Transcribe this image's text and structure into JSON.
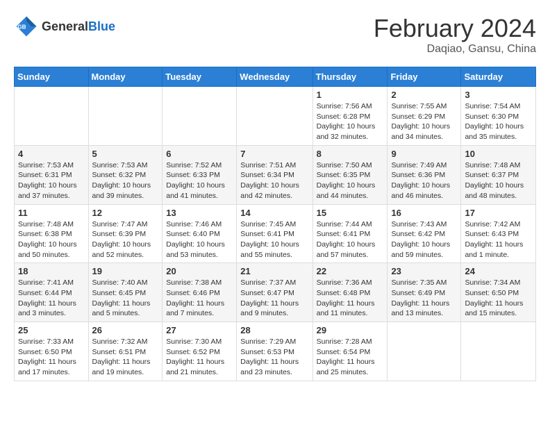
{
  "logo": {
    "general": "General",
    "blue": "Blue"
  },
  "header": {
    "month": "February 2024",
    "location": "Daqiao, Gansu, China"
  },
  "weekdays": [
    "Sunday",
    "Monday",
    "Tuesday",
    "Wednesday",
    "Thursday",
    "Friday",
    "Saturday"
  ],
  "weeks": [
    [
      {
        "day": "",
        "info": ""
      },
      {
        "day": "",
        "info": ""
      },
      {
        "day": "",
        "info": ""
      },
      {
        "day": "",
        "info": ""
      },
      {
        "day": "1",
        "info": "Sunrise: 7:56 AM\nSunset: 6:28 PM\nDaylight: 10 hours\nand 32 minutes."
      },
      {
        "day": "2",
        "info": "Sunrise: 7:55 AM\nSunset: 6:29 PM\nDaylight: 10 hours\nand 34 minutes."
      },
      {
        "day": "3",
        "info": "Sunrise: 7:54 AM\nSunset: 6:30 PM\nDaylight: 10 hours\nand 35 minutes."
      }
    ],
    [
      {
        "day": "4",
        "info": "Sunrise: 7:53 AM\nSunset: 6:31 PM\nDaylight: 10 hours\nand 37 minutes."
      },
      {
        "day": "5",
        "info": "Sunrise: 7:53 AM\nSunset: 6:32 PM\nDaylight: 10 hours\nand 39 minutes."
      },
      {
        "day": "6",
        "info": "Sunrise: 7:52 AM\nSunset: 6:33 PM\nDaylight: 10 hours\nand 41 minutes."
      },
      {
        "day": "7",
        "info": "Sunrise: 7:51 AM\nSunset: 6:34 PM\nDaylight: 10 hours\nand 42 minutes."
      },
      {
        "day": "8",
        "info": "Sunrise: 7:50 AM\nSunset: 6:35 PM\nDaylight: 10 hours\nand 44 minutes."
      },
      {
        "day": "9",
        "info": "Sunrise: 7:49 AM\nSunset: 6:36 PM\nDaylight: 10 hours\nand 46 minutes."
      },
      {
        "day": "10",
        "info": "Sunrise: 7:48 AM\nSunset: 6:37 PM\nDaylight: 10 hours\nand 48 minutes."
      }
    ],
    [
      {
        "day": "11",
        "info": "Sunrise: 7:48 AM\nSunset: 6:38 PM\nDaylight: 10 hours\nand 50 minutes."
      },
      {
        "day": "12",
        "info": "Sunrise: 7:47 AM\nSunset: 6:39 PM\nDaylight: 10 hours\nand 52 minutes."
      },
      {
        "day": "13",
        "info": "Sunrise: 7:46 AM\nSunset: 6:40 PM\nDaylight: 10 hours\nand 53 minutes."
      },
      {
        "day": "14",
        "info": "Sunrise: 7:45 AM\nSunset: 6:41 PM\nDaylight: 10 hours\nand 55 minutes."
      },
      {
        "day": "15",
        "info": "Sunrise: 7:44 AM\nSunset: 6:41 PM\nDaylight: 10 hours\nand 57 minutes."
      },
      {
        "day": "16",
        "info": "Sunrise: 7:43 AM\nSunset: 6:42 PM\nDaylight: 10 hours\nand 59 minutes."
      },
      {
        "day": "17",
        "info": "Sunrise: 7:42 AM\nSunset: 6:43 PM\nDaylight: 11 hours\nand 1 minute."
      }
    ],
    [
      {
        "day": "18",
        "info": "Sunrise: 7:41 AM\nSunset: 6:44 PM\nDaylight: 11 hours\nand 3 minutes."
      },
      {
        "day": "19",
        "info": "Sunrise: 7:40 AM\nSunset: 6:45 PM\nDaylight: 11 hours\nand 5 minutes."
      },
      {
        "day": "20",
        "info": "Sunrise: 7:38 AM\nSunset: 6:46 PM\nDaylight: 11 hours\nand 7 minutes."
      },
      {
        "day": "21",
        "info": "Sunrise: 7:37 AM\nSunset: 6:47 PM\nDaylight: 11 hours\nand 9 minutes."
      },
      {
        "day": "22",
        "info": "Sunrise: 7:36 AM\nSunset: 6:48 PM\nDaylight: 11 hours\nand 11 minutes."
      },
      {
        "day": "23",
        "info": "Sunrise: 7:35 AM\nSunset: 6:49 PM\nDaylight: 11 hours\nand 13 minutes."
      },
      {
        "day": "24",
        "info": "Sunrise: 7:34 AM\nSunset: 6:50 PM\nDaylight: 11 hours\nand 15 minutes."
      }
    ],
    [
      {
        "day": "25",
        "info": "Sunrise: 7:33 AM\nSunset: 6:50 PM\nDaylight: 11 hours\nand 17 minutes."
      },
      {
        "day": "26",
        "info": "Sunrise: 7:32 AM\nSunset: 6:51 PM\nDaylight: 11 hours\nand 19 minutes."
      },
      {
        "day": "27",
        "info": "Sunrise: 7:30 AM\nSunset: 6:52 PM\nDaylight: 11 hours\nand 21 minutes."
      },
      {
        "day": "28",
        "info": "Sunrise: 7:29 AM\nSunset: 6:53 PM\nDaylight: 11 hours\nand 23 minutes."
      },
      {
        "day": "29",
        "info": "Sunrise: 7:28 AM\nSunset: 6:54 PM\nDaylight: 11 hours\nand 25 minutes."
      },
      {
        "day": "",
        "info": ""
      },
      {
        "day": "",
        "info": ""
      }
    ]
  ]
}
